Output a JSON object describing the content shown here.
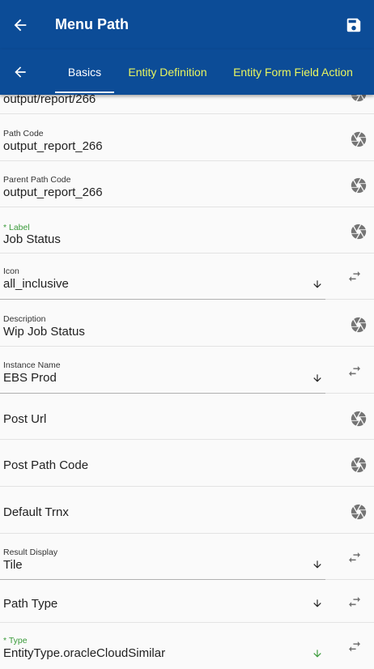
{
  "appbar": {
    "title": "Menu Path"
  },
  "tabs": {
    "basics": "Basics",
    "entity_definition": "Entity Definition",
    "entity_form_field_action": "Entity Form Field Action"
  },
  "fields": {
    "path_partial": {
      "value": "output/report/266"
    },
    "path_code": {
      "label": "Path Code",
      "value": "output_report_266"
    },
    "parent_path_code": {
      "label": "Parent Path Code",
      "value": "output_report_266"
    },
    "label": {
      "label": "* Label",
      "value": "Job Status"
    },
    "icon": {
      "label": "Icon",
      "value": "all_inclusive"
    },
    "description": {
      "label": "Description",
      "value": "Wip Job Status"
    },
    "instance_name": {
      "label": "Instance Name",
      "value": "EBS Prod"
    },
    "post_url": {
      "placeholder": "Post Url"
    },
    "post_path_code": {
      "placeholder": "Post Path Code"
    },
    "default_trnx": {
      "placeholder": "Default Trnx"
    },
    "result_display": {
      "label": "Result Display",
      "value": "Tile"
    },
    "path_type": {
      "placeholder": "Path Type"
    },
    "type": {
      "label": "* Type",
      "value": "EntityType.oracleCloudSimilar"
    }
  },
  "colors": {
    "primary": "#0c4c97",
    "tab_inactive": "#e8f560",
    "required_label": "#3a9a3a",
    "icon_gray": "#757575"
  },
  "icons": [
    "arrow-left-icon",
    "save-icon",
    "camera-shutter-icon",
    "swap-horiz-icon",
    "arrow-down-icon"
  ]
}
